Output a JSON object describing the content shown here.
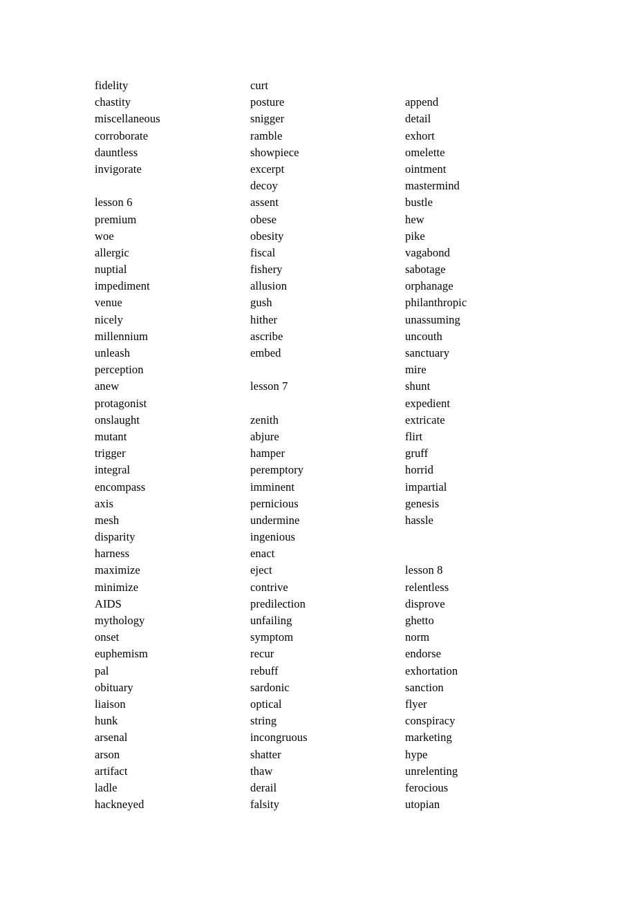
{
  "document": {
    "type": "vocabulary-word-list",
    "layout": "three-column",
    "columns": [
      {
        "name": "column-1",
        "entries": [
          "fidelity",
          "chastity",
          "miscellaneous",
          "corroborate",
          "dauntless",
          "invigorate",
          "",
          "lesson 6",
          "premium",
          "woe",
          "allergic",
          "nuptial",
          "impediment",
          "venue",
          "nicely",
          "millennium",
          "unleash",
          "perception",
          "anew",
          "protagonist",
          "onslaught",
          "mutant",
          "trigger",
          "integral",
          "encompass",
          "axis",
          "mesh",
          "disparity",
          "harness",
          "maximize",
          "minimize",
          "AIDS",
          "mythology",
          "onset",
          "euphemism",
          "pal",
          "obituary",
          "liaison",
          "hunk",
          "arsenal",
          "arson",
          "artifact",
          "ladle",
          "hackneyed"
        ]
      },
      {
        "name": "column-2",
        "entries": [
          "curt",
          "posture",
          "snigger",
          "ramble",
          "showpiece",
          "excerpt",
          "decoy",
          "assent",
          "obese",
          "obesity",
          "fiscal",
          "fishery",
          "allusion",
          "gush",
          "hither",
          "ascribe",
          "embed",
          "",
          "lesson 7",
          "",
          "zenith",
          "abjure",
          "hamper",
          "peremptory",
          "imminent",
          "pernicious",
          "undermine",
          "ingenious",
          "enact",
          "eject",
          "contrive",
          "predilection",
          "unfailing",
          "symptom",
          "recur",
          "rebuff",
          "sardonic",
          "optical",
          "string",
          "incongruous",
          "shatter",
          "thaw",
          "derail",
          "falsity"
        ]
      },
      {
        "name": "column-3",
        "entries": [
          "",
          "append",
          "detail",
          "exhort",
          "omelette",
          "ointment",
          "mastermind",
          "bustle",
          "hew",
          "pike",
          "vagabond",
          "sabotage",
          "orphanage",
          "philanthropic",
          "unassuming",
          "uncouth",
          "sanctuary",
          "mire",
          "shunt",
          "expedient",
          "extricate",
          "flirt",
          "gruff",
          "horrid",
          "impartial",
          "genesis",
          "hassle",
          "",
          "",
          "lesson 8",
          "relentless",
          "disprove",
          "ghetto",
          "norm",
          "endorse",
          "exhortation",
          "sanction",
          "flyer",
          "conspiracy",
          "marketing",
          "hype",
          "unrelenting",
          "ferocious",
          "utopian"
        ]
      }
    ]
  },
  "colors": {
    "page_background": "#ffffff",
    "text": "#000000"
  }
}
